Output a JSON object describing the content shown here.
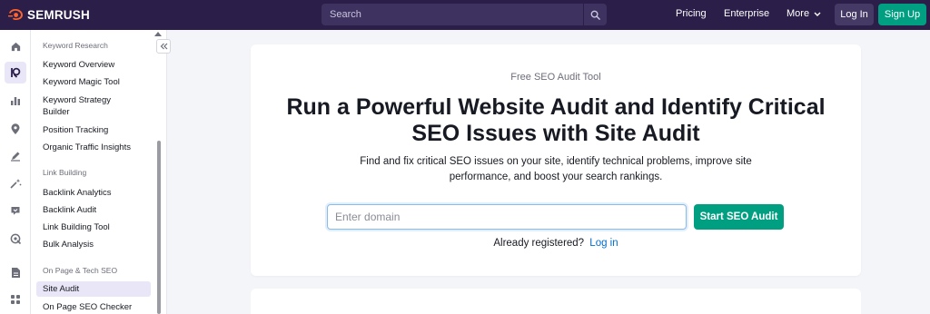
{
  "header": {
    "brand": "SEMRUSH",
    "search_placeholder": "Search",
    "nav": {
      "pricing": "Pricing",
      "enterprise": "Enterprise",
      "more": "More"
    },
    "login_label": "Log In",
    "signup_label": "Sign Up"
  },
  "rail": {
    "icons": [
      "home-icon",
      "seo-icon",
      "analytics-icon",
      "local-icon",
      "content-icon",
      "ai-icon",
      "social-icon",
      "ads-icon",
      "reports-icon",
      "apps-icon"
    ],
    "active": "seo-icon"
  },
  "sidebar": {
    "keyword_research": {
      "heading": "Keyword Research",
      "items": [
        "Keyword Overview",
        "Keyword Magic Tool",
        "Keyword Strategy Builder",
        "Position Tracking",
        "Organic Traffic Insights"
      ]
    },
    "link_building": {
      "heading": "Link Building",
      "items": [
        "Backlink Analytics",
        "Backlink Audit",
        "Link Building Tool",
        "Bulk Analysis"
      ]
    },
    "on_page": {
      "heading": "On Page & Tech SEO",
      "items": [
        "Site Audit",
        "On Page SEO Checker"
      ]
    },
    "active_item": "Site Audit"
  },
  "main": {
    "eyebrow": "Free SEO Audit Tool",
    "headline": "Run a Powerful Website Audit and Identify Critical SEO Issues with Site Audit",
    "subtext": "Find and fix critical SEO issues on your site, identify technical problems, improve site performance, and boost your search rankings.",
    "domain_placeholder": "Enter domain",
    "domain_value": "",
    "cta_label": "Start SEO Audit",
    "registered_text": "Already registered?",
    "login_link": "Log in"
  },
  "colors": {
    "topbar": "#2b1f4a",
    "accent_green": "#009f81",
    "active_bg": "#e9e6f7",
    "link_blue": "#006dca"
  }
}
